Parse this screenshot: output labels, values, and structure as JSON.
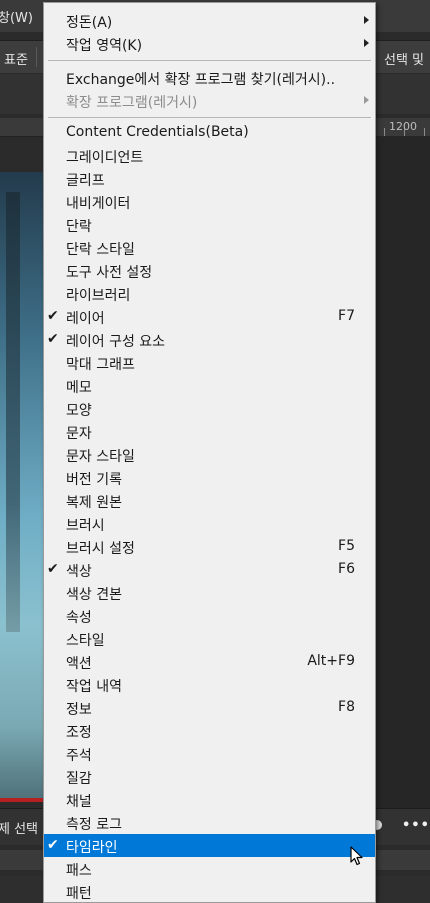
{
  "app": {
    "menubar_title": "창(W)",
    "options_left": "표준",
    "options_right": "선택 및",
    "ruler_label": "1200",
    "bottom_text": "제 선택",
    "bottom_more": "•••"
  },
  "menu": {
    "top_items": [
      {
        "label": "정돈(A)",
        "submenu": true
      },
      {
        "label": "작업 영역(K)",
        "submenu": true
      }
    ],
    "exchange_items": [
      {
        "label": "Exchange에서 확장 프로그램 찾기(레거시)..",
        "submenu": false,
        "disabled": false
      },
      {
        "label": "확장 프로그램(레거시)",
        "submenu": true,
        "disabled": true
      }
    ],
    "panel_items": [
      {
        "label": "Content Credentials(Beta)",
        "checked": false,
        "shortcut": ""
      },
      {
        "label": "그레이디언트",
        "checked": false,
        "shortcut": ""
      },
      {
        "label": "글리프",
        "checked": false,
        "shortcut": ""
      },
      {
        "label": "내비게이터",
        "checked": false,
        "shortcut": ""
      },
      {
        "label": "단락",
        "checked": false,
        "shortcut": ""
      },
      {
        "label": "단락 스타일",
        "checked": false,
        "shortcut": ""
      },
      {
        "label": "도구 사전 설정",
        "checked": false,
        "shortcut": ""
      },
      {
        "label": "라이브러리",
        "checked": false,
        "shortcut": ""
      },
      {
        "label": "레이어",
        "checked": true,
        "shortcut": "F7"
      },
      {
        "label": "레이어 구성 요소",
        "checked": true,
        "shortcut": ""
      },
      {
        "label": "막대 그래프",
        "checked": false,
        "shortcut": ""
      },
      {
        "label": "메모",
        "checked": false,
        "shortcut": ""
      },
      {
        "label": "모양",
        "checked": false,
        "shortcut": ""
      },
      {
        "label": "문자",
        "checked": false,
        "shortcut": ""
      },
      {
        "label": "문자 스타일",
        "checked": false,
        "shortcut": ""
      },
      {
        "label": "버전 기록",
        "checked": false,
        "shortcut": ""
      },
      {
        "label": "복제 원본",
        "checked": false,
        "shortcut": ""
      },
      {
        "label": "브러시",
        "checked": false,
        "shortcut": ""
      },
      {
        "label": "브러시 설정",
        "checked": false,
        "shortcut": "F5"
      },
      {
        "label": "색상",
        "checked": true,
        "shortcut": "F6"
      },
      {
        "label": "색상 견본",
        "checked": false,
        "shortcut": ""
      },
      {
        "label": "속성",
        "checked": false,
        "shortcut": ""
      },
      {
        "label": "스타일",
        "checked": false,
        "shortcut": ""
      },
      {
        "label": "액션",
        "checked": false,
        "shortcut": "Alt+F9"
      },
      {
        "label": "작업 내역",
        "checked": false,
        "shortcut": ""
      },
      {
        "label": "정보",
        "checked": false,
        "shortcut": "F8"
      },
      {
        "label": "조정",
        "checked": false,
        "shortcut": ""
      },
      {
        "label": "주석",
        "checked": false,
        "shortcut": ""
      },
      {
        "label": "질감",
        "checked": false,
        "shortcut": ""
      },
      {
        "label": "채널",
        "checked": false,
        "shortcut": ""
      },
      {
        "label": "측정 로그",
        "checked": false,
        "shortcut": ""
      },
      {
        "label": "타임라인",
        "checked": true,
        "shortcut": "",
        "highlighted": true
      },
      {
        "label": "패스",
        "checked": false,
        "shortcut": ""
      },
      {
        "label": "패턴",
        "checked": false,
        "shortcut": ""
      }
    ],
    "check_glyph": "✔"
  },
  "colors": {
    "menu_bg": "#f0f0f0",
    "highlight": "#0078d7",
    "app_bg": "#2b2b2b"
  }
}
